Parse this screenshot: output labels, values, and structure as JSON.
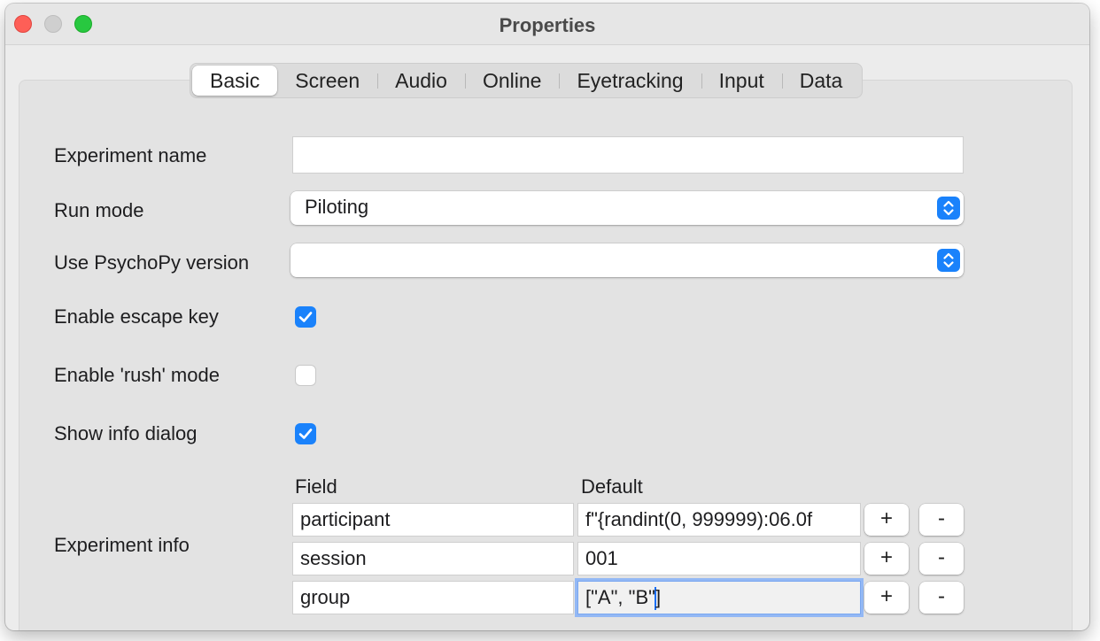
{
  "window": {
    "title": "Properties"
  },
  "tabs": [
    {
      "label": "Basic"
    },
    {
      "label": "Screen"
    },
    {
      "label": "Audio"
    },
    {
      "label": "Online"
    },
    {
      "label": "Eyetracking"
    },
    {
      "label": "Input"
    },
    {
      "label": "Data"
    }
  ],
  "active_tab": "Basic",
  "form": {
    "experiment_name": {
      "label": "Experiment name",
      "value": ""
    },
    "run_mode": {
      "label": "Run mode",
      "value": "Piloting"
    },
    "psychopy_version": {
      "label": "Use PsychoPy version",
      "value": ""
    },
    "escape_key": {
      "label": "Enable escape key",
      "checked": true
    },
    "rush_mode": {
      "label": "Enable 'rush' mode",
      "checked": false
    },
    "info_dialog": {
      "label": "Show info dialog",
      "checked": true
    },
    "experiment_info": {
      "label": "Experiment info",
      "field_header": "Field",
      "default_header": "Default",
      "rows": [
        {
          "field": "participant",
          "default": "f\"{randint(0, 999999):06.0f"
        },
        {
          "field": "session",
          "default": "001"
        },
        {
          "field": "group",
          "default_before_caret": "[\"A\", \"B\"",
          "default_after_caret": "]"
        }
      ],
      "add_label": "+",
      "remove_label": "-"
    }
  },
  "colors": {
    "accent": "#1a82fb",
    "close": "#fe5f57",
    "maximize": "#28c840"
  },
  "icons": {
    "select_arrows": "updown-chevron-icon",
    "checkmark": "checkmark-icon"
  }
}
